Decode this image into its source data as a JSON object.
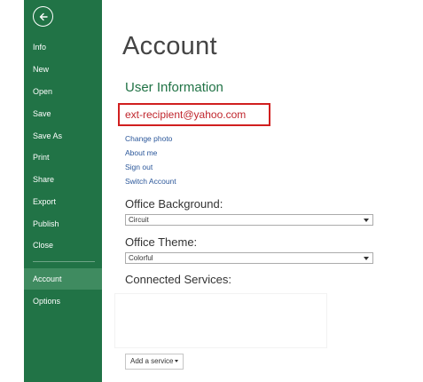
{
  "sidebar": {
    "back_icon": "back-arrow-icon",
    "accent_color": "#217346",
    "items": [
      {
        "label": "Info"
      },
      {
        "label": "New"
      },
      {
        "label": "Open"
      },
      {
        "label": "Save"
      },
      {
        "label": "Save As"
      },
      {
        "label": "Print"
      },
      {
        "label": "Share"
      },
      {
        "label": "Export"
      },
      {
        "label": "Publish"
      },
      {
        "label": "Close"
      },
      {
        "label": "Account",
        "active": true
      },
      {
        "label": "Options"
      }
    ]
  },
  "main": {
    "title": "Account",
    "user_info": {
      "heading": "User Information",
      "email": "ext-recipient@yahoo.com",
      "highlight_color": "#d11f1f",
      "links": [
        "Change photo",
        "About me",
        "Sign out",
        "Switch Account"
      ]
    },
    "background": {
      "label": "Office Background:",
      "selected": "Circuit"
    },
    "theme": {
      "label": "Office Theme:",
      "selected": "Colorful"
    },
    "services": {
      "label": "Connected Services:",
      "add_button": "Add a service"
    }
  }
}
